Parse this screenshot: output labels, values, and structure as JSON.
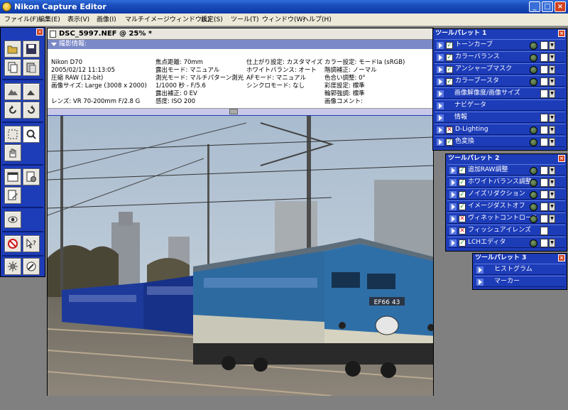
{
  "window": {
    "title": "Nikon Capture Editor"
  },
  "menus": [
    "ファイル(F)",
    "編集(E)",
    "表示(V)",
    "画像(I)",
    "マルチイメージウィンドウ(L)",
    "設定(S)",
    "ツール(T)",
    "ウィンドウ(W)",
    "ヘルプ(H)"
  ],
  "image_window": {
    "title": "DSC_5997.NEF @ 25% *",
    "info_header": "撮影情報:",
    "info_col1": [
      "Nikon D70",
      "2005/02/12 11:13:05",
      "圧縮 RAW (12-bit)",
      "画像サイズ: Large (3008 x 2000)",
      "",
      "レンズ: VR 70-200mm F/2.8 G"
    ],
    "info_col2": [
      "焦点距離: 70mm",
      "露出モード: マニュアル",
      "測光モード: マルチパターン測光",
      "1/1000 秒 - F/5.6",
      "露出補正: 0 EV",
      "感度: ISO 200"
    ],
    "info_col3": [
      "仕上がり設定: カスタマイズ",
      "ホワイトバランス: オート",
      "AFモード: マニュアル",
      "シンクロモード: なし"
    ],
    "info_col4": [
      "カラー設定: モードIa (sRGB)",
      "階調補正: ノーマル",
      "色合い調整: 0°",
      "彩度設定: 標準",
      "輪郭強調: 標準",
      "画像コメント:"
    ],
    "plate": "EF66 43"
  },
  "palette1": {
    "title": "ツールパレット 1",
    "rows": [
      {
        "label": "トーンカーブ",
        "check": "ok",
        "extras": true
      },
      {
        "label": "カラーバランス",
        "check": "ok",
        "extras": true
      },
      {
        "label": "アンシャープマスク",
        "check": "ok",
        "extras": true
      },
      {
        "label": "カラーブースタ",
        "check": "ok",
        "extras": true
      },
      {
        "label": "画像解像度/画像サイズ",
        "check": "ok",
        "extras": true
      },
      {
        "label": "ナビゲータ",
        "check": "none",
        "extras": false
      },
      {
        "label": "情報",
        "check": "none",
        "extras": true
      },
      {
        "label": "D-Lighting",
        "check": "x",
        "extras": true
      },
      {
        "label": "色変換",
        "check": "ok",
        "extras": true
      }
    ]
  },
  "palette2": {
    "title": "ツールパレット 2",
    "rows": [
      {
        "label": "追加RAW調整",
        "check": "ok"
      },
      {
        "label": "ホワイトバランス調整",
        "check": "ok"
      },
      {
        "label": "ノイズリダクション",
        "check": "ok"
      },
      {
        "label": "イメージダストオフ",
        "check": "ok"
      },
      {
        "label": "ヴィネットコントロール",
        "check": "x"
      },
      {
        "label": "フィッシュアイレンズ",
        "check": "x"
      },
      {
        "label": "LCHエディタ",
        "check": "ok"
      }
    ]
  },
  "palette3": {
    "title": "ツールパレット 3",
    "rows": [
      {
        "label": "ヒストグラム"
      },
      {
        "label": "マーカー"
      }
    ]
  }
}
